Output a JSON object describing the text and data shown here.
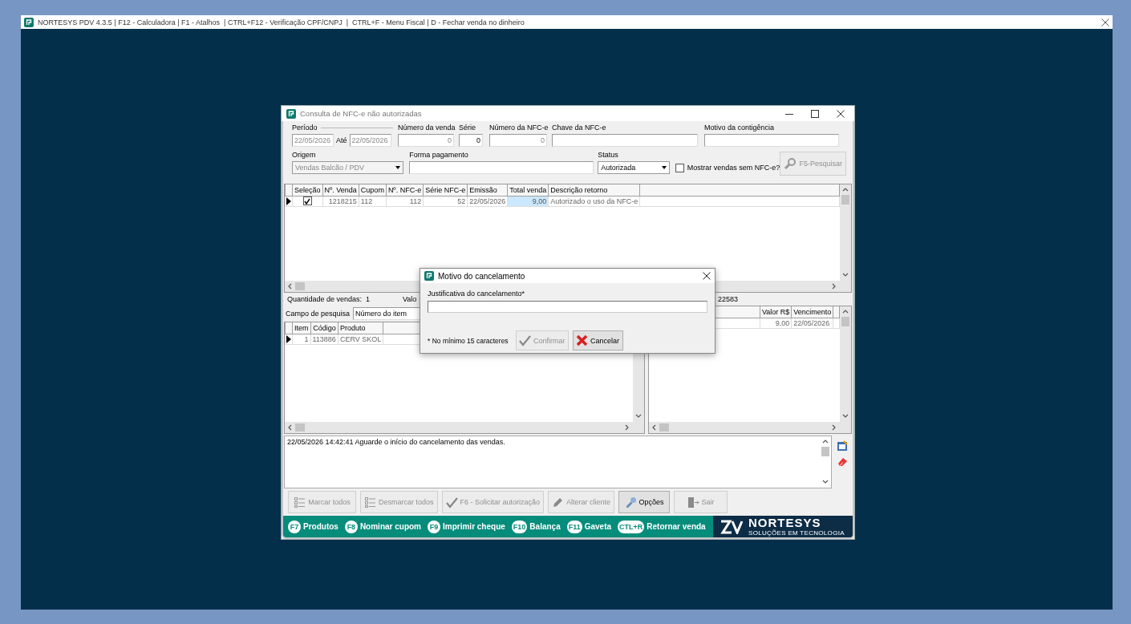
{
  "app": {
    "title": "NORTESYS PDV 4.3.5 | F12 - Calculadora | F1 - Atalhos  | CTRL+F12 - Verificação CPF/CNPJ  |  CTRL+F - Menu Fiscal | D - Fechar venda no dinheiro"
  },
  "window": {
    "title": "Consulta de NFC-e não autorizadas"
  },
  "filters": {
    "periodo": {
      "label": "Período",
      "from": "22/05/2026",
      "to_label": "Até",
      "to": "22/05/2026",
      "disabled": true
    },
    "fields": [
      {
        "label": "Número da venda",
        "value": "0",
        "disabled": true
      },
      {
        "label": "Série",
        "value": "0",
        "disabled": false
      },
      {
        "label": "Número da NFC-e",
        "value": "0",
        "disabled": true
      },
      {
        "label": "Chave da NFC-e"
      },
      {
        "label": "Motivo da contigência"
      }
    ],
    "origem": {
      "label": "Origem",
      "value": "Vendas Balcão / PDV",
      "disabled": true
    },
    "forma_pagamento": {
      "label": "Forma pagamento"
    },
    "status": {
      "label": "Status",
      "value": "Autorizada",
      "disabled": false
    },
    "sem_nfce": {
      "label": "Mostrar vendas sem NFC-e?",
      "checked": false
    },
    "search_button": {
      "label": "F5-Pesquisar",
      "disabled": true
    }
  },
  "sales_table": {
    "columns": [
      {
        "label": "Seleção",
        "kind": "check",
        "focused": false
      },
      {
        "label": "Nº. Venda",
        "kind": "number",
        "focused": false
      },
      {
        "label": "Cupom",
        "kind": "text",
        "focused": false
      },
      {
        "label": "Nº. NFC-e",
        "kind": "number",
        "focused": false
      },
      {
        "label": "Série NFC-e",
        "kind": "number",
        "focused": false
      },
      {
        "label": "Emissão",
        "kind": "text",
        "focused": false
      },
      {
        "label": "Total venda",
        "kind": "number",
        "focused": true
      },
      {
        "label": "Descrição retorno",
        "kind": "text",
        "focused": false
      }
    ],
    "rows": [
      {
        "current": true,
        "checked": true,
        "cells": [
          "",
          "1218215",
          "112",
          "112",
          "52",
          "22/05/2026",
          "9,00",
          "Autorizado o uso da NFC-e"
        ]
      }
    ]
  },
  "summary": {
    "quantity": "Quantidade de vendas:  1",
    "column_2": "Valo",
    "column_3": "22583"
  },
  "search": {
    "label": "Campo de pesquisa",
    "value": "Número do item"
  },
  "items_table": {
    "columns": [
      {
        "label": "Item",
        "kind": "number"
      },
      {
        "label": "Código",
        "kind": "number"
      },
      {
        "label": "Produto",
        "kind": "text"
      }
    ],
    "rows": [
      {
        "current": true,
        "cells": [
          "1",
          "113886",
          "CERV SKOL"
        ]
      }
    ]
  },
  "payments_table": {
    "columns": [
      {
        "label": "Valor R$",
        "kind": "number"
      },
      {
        "label": "Vencimento",
        "kind": "text"
      }
    ],
    "rows": [
      {
        "cells": [
          "9,00",
          "22/05/2026"
        ]
      }
    ]
  },
  "log": {
    "text": "22/05/2026 14:42:41 Aguarde o início do cancelamento das vendas."
  },
  "actions": [
    {
      "label": "Marcar todos",
      "kind": "mark-all",
      "disabled": true
    },
    {
      "label": "Desmarcar todos",
      "kind": "unmark-all",
      "disabled": true
    },
    {
      "label": "F6 - Solicitar autorização",
      "kind": "authorize",
      "disabled": true
    },
    {
      "label": "Alterar cliente",
      "kind": "edit-client",
      "disabled": true
    },
    {
      "label": "Opções",
      "kind": "options",
      "disabled": false
    },
    {
      "label": "Sair",
      "kind": "exit",
      "disabled": true
    }
  ],
  "shortcuts": [
    {
      "key": "F7",
      "label": "Produtos"
    },
    {
      "key": "F8",
      "label": "Nominar cupom"
    },
    {
      "key": "F9",
      "label": "Imprimir cheque"
    },
    {
      "key": "F10",
      "label": "Balança"
    },
    {
      "key": "F11",
      "label": "Gaveta"
    },
    {
      "key": "CTL+R",
      "label": "Retornar venda"
    }
  ],
  "logo": {
    "name": "NORTESYS",
    "tagline": "SOLUÇÕES EM TECNOLOGIA"
  },
  "modal": {
    "title": "Motivo do cancelamento",
    "field_label": "Justificativa do cancelamento*",
    "note": "* No mínimo 15 caracteres",
    "buttons": [
      {
        "label": "Confirmar",
        "kind": "confirm",
        "disabled": true
      },
      {
        "label": "Cancelar",
        "kind": "cancel",
        "disabled": false
      }
    ]
  }
}
